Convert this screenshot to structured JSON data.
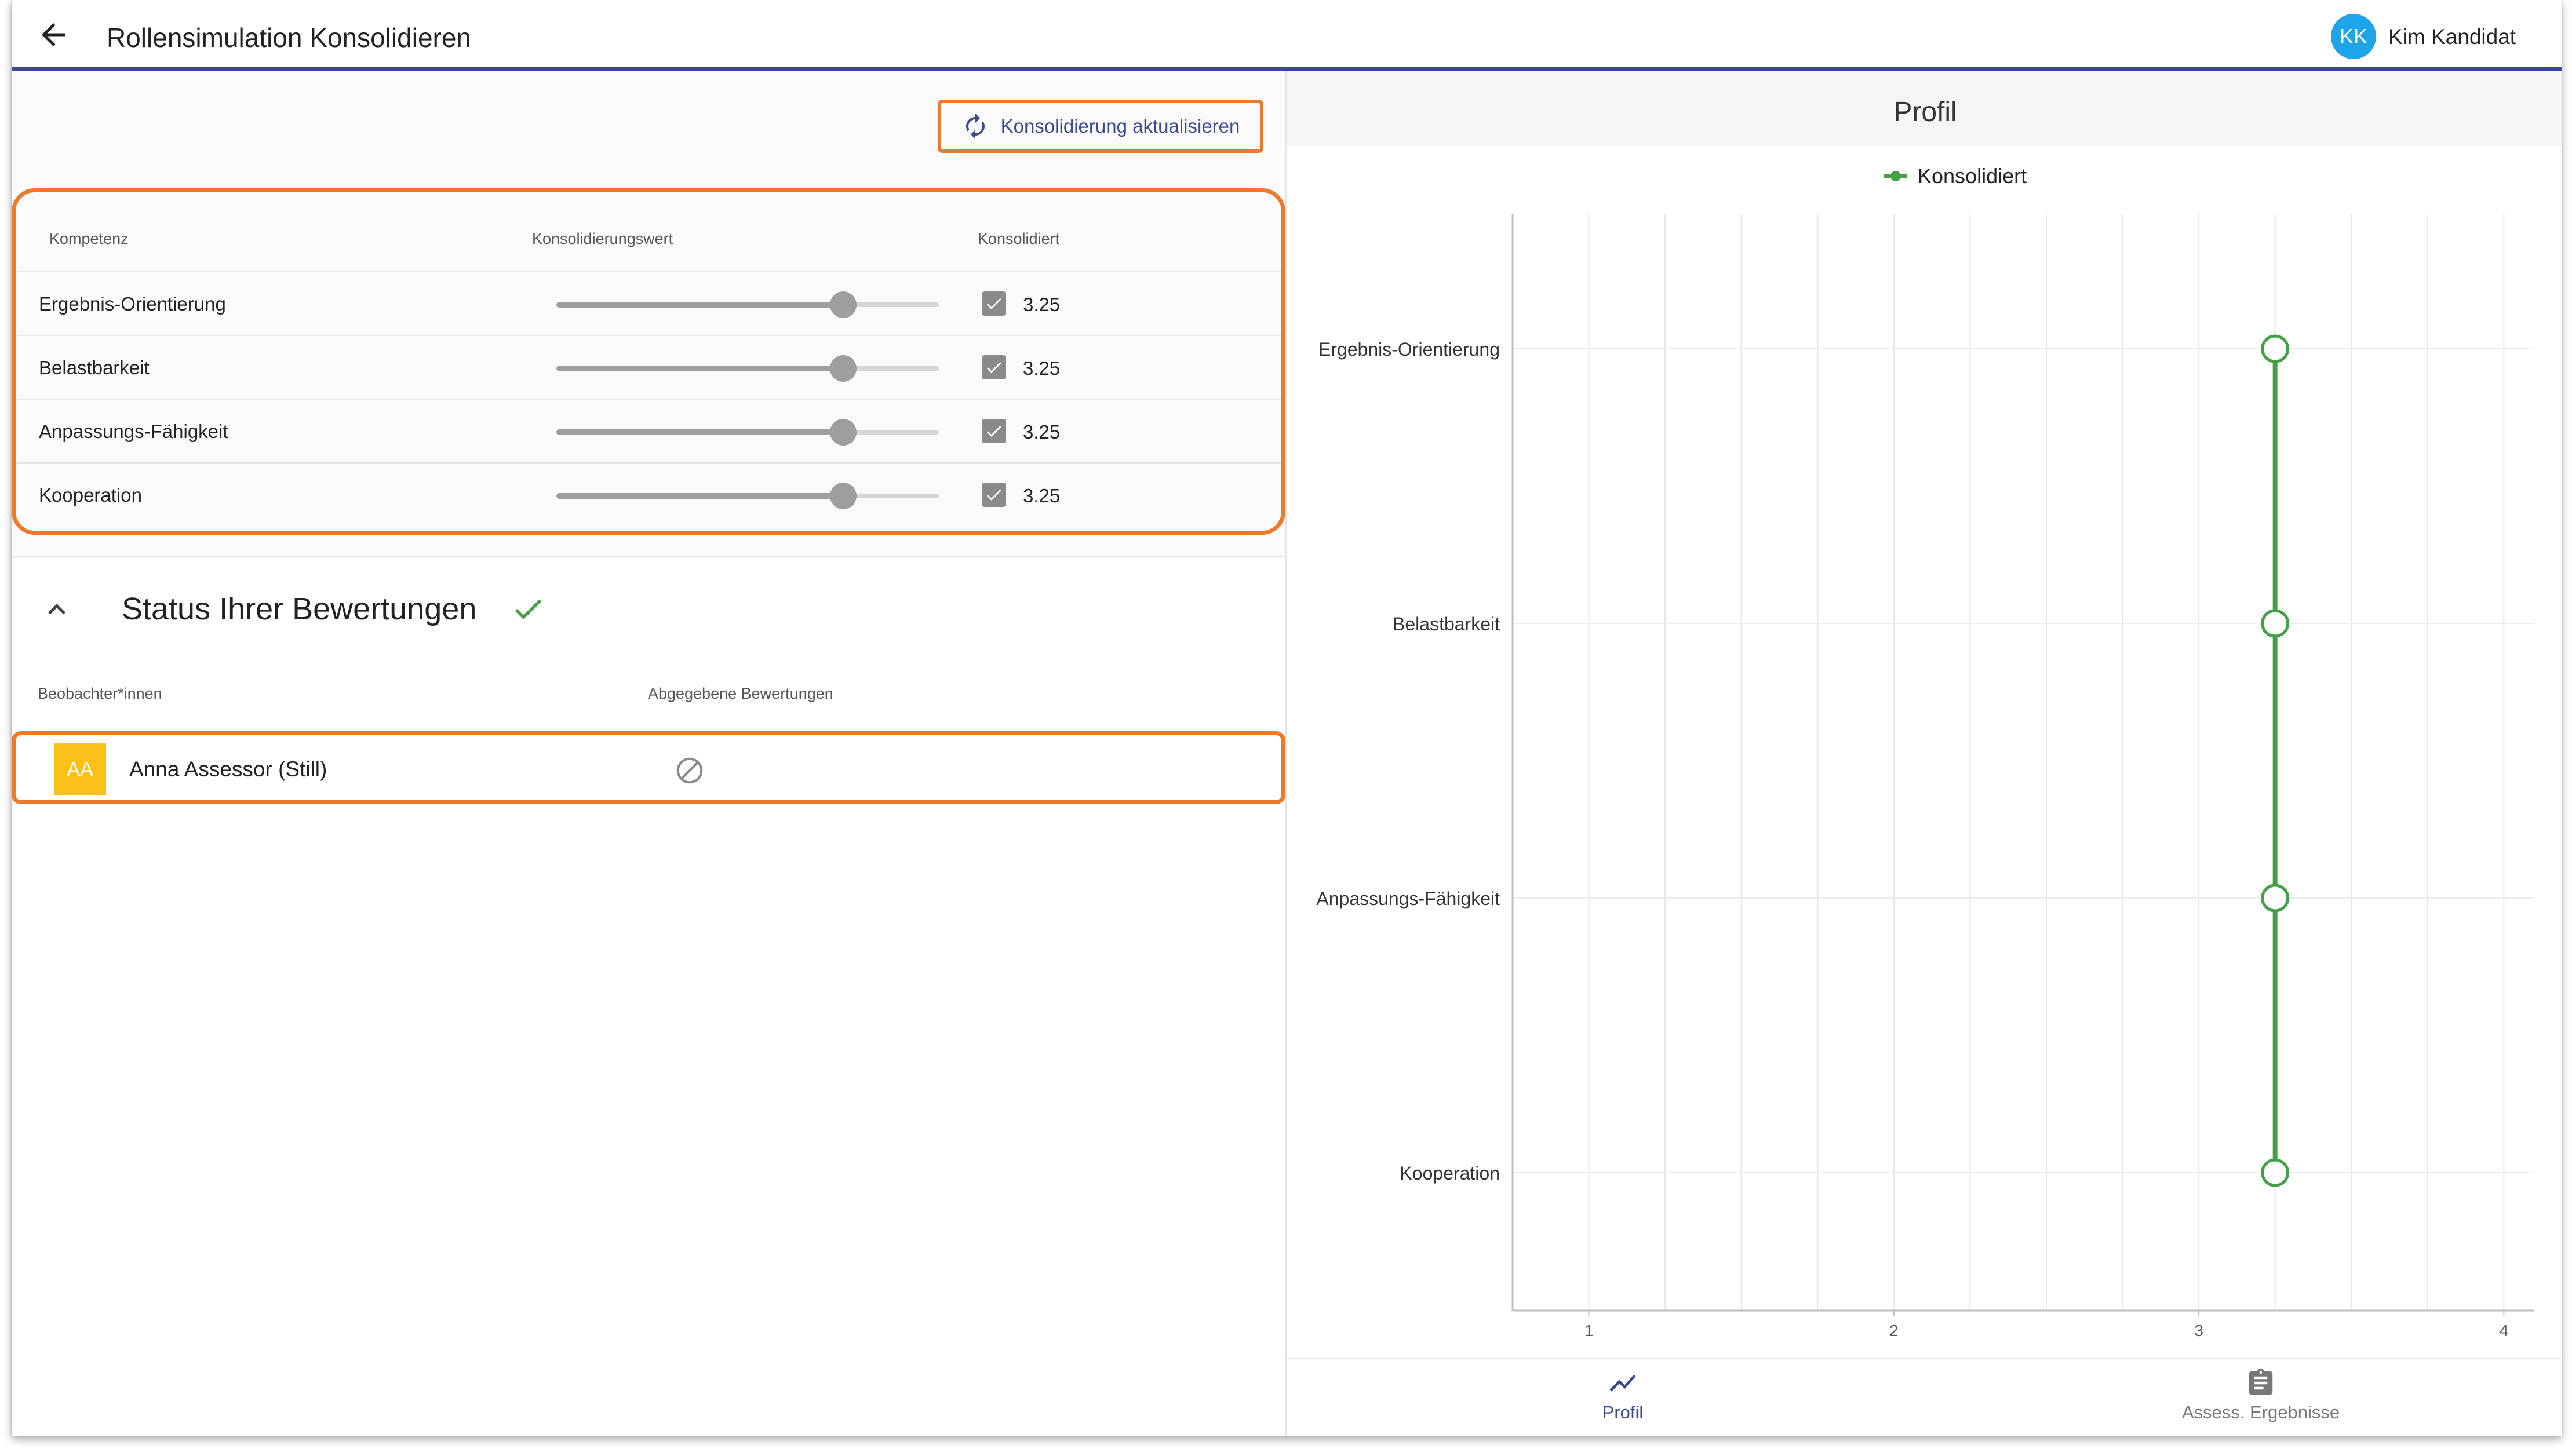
{
  "header": {
    "title": "Rollensimulation Konsolidieren",
    "user_initials": "KK",
    "user_name": "Kim Kandidat"
  },
  "actions": {
    "update_label": "Konsolidierung aktualisieren"
  },
  "competency_table": {
    "columns": [
      "Kompetenz",
      "Konsolidierungswert",
      "Konsolidiert"
    ],
    "rows": [
      {
        "name": "Ergebnis-Orientierung",
        "slider_fraction": 0.75,
        "checked": true,
        "value": "3.25"
      },
      {
        "name": "Belastbarkeit",
        "slider_fraction": 0.75,
        "checked": true,
        "value": "3.25"
      },
      {
        "name": "Anpassungs-Fähigkeit",
        "slider_fraction": 0.75,
        "checked": true,
        "value": "3.25"
      },
      {
        "name": "Kooperation",
        "slider_fraction": 0.75,
        "checked": true,
        "value": "3.25"
      }
    ]
  },
  "status": {
    "title": "Status Ihrer Bewertungen",
    "columns": [
      "Beobachter*innen",
      "Abgegebene Bewertungen"
    ],
    "observers": [
      {
        "initials": "AA",
        "name": "Anna Assessor (Still)",
        "submitted_icon": "block-icon"
      }
    ]
  },
  "profile": {
    "title": "Profil"
  },
  "chart_data": {
    "type": "line",
    "orientation": "horizontal",
    "categories": [
      "Ergebnis-Orientierung",
      "Belastbarkeit",
      "Anpassungs-Fähigkeit",
      "Kooperation"
    ],
    "series": [
      {
        "name": "Konsolidiert",
        "values": [
          3.25,
          3.25,
          3.25,
          3.25
        ],
        "color": "#43a047"
      }
    ],
    "x_ticks": [
      "1",
      "2",
      "3",
      "4"
    ],
    "xlim": [
      0.75,
      4.1
    ],
    "grid": true,
    "legend_position": "top-center"
  },
  "bottom_nav": {
    "items": [
      {
        "label": "Profil",
        "icon": "chart-line-icon",
        "active": true
      },
      {
        "label": "Assess. Ergebnisse",
        "icon": "clipboard-icon",
        "active": false
      }
    ]
  },
  "colors": {
    "accent": "#3b4a8f",
    "highlight": "#ec7a2c",
    "series": "#43a047",
    "avatar_user": "#1ea5e9",
    "avatar_observer": "#f9c11a"
  }
}
